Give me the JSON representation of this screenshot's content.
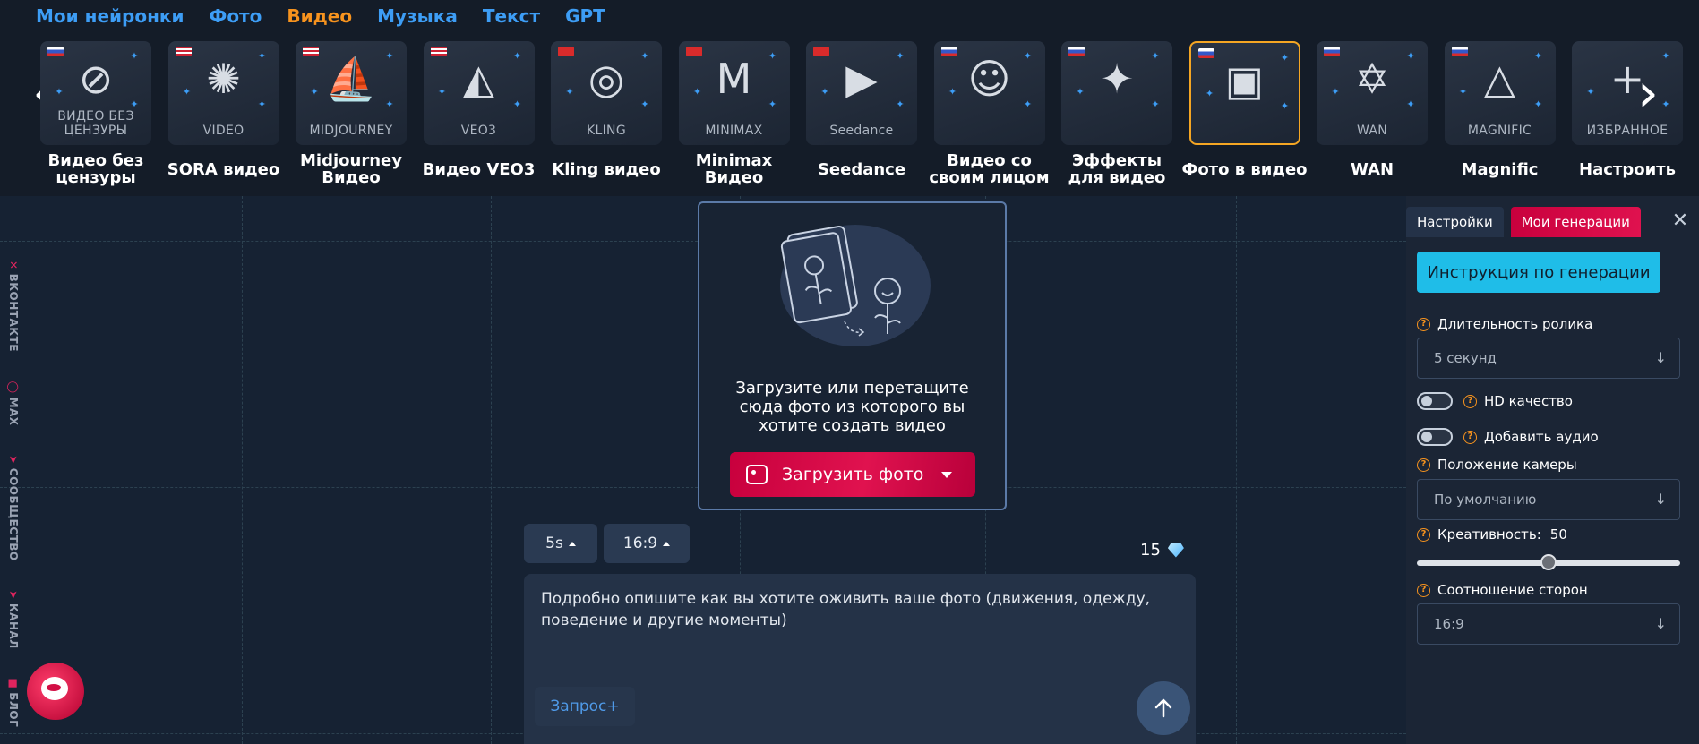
{
  "topnav": {
    "items": [
      {
        "label": "Мои нейронки",
        "active": false
      },
      {
        "label": "Фото",
        "active": false
      },
      {
        "label": "Видео",
        "active": true
      },
      {
        "label": "Музыка",
        "active": false
      },
      {
        "label": "Текст",
        "active": false
      },
      {
        "label": "GPT",
        "active": false
      }
    ]
  },
  "carousel": {
    "prev_icon": "chevron-left-icon",
    "next_icon": "chevron-right-icon",
    "cards": [
      {
        "sub": "ВИДЕО БЕЗ ЦЕНЗУРЫ",
        "title": "Видео без цензуры",
        "flag": "ru",
        "icon": "no-sign-icon",
        "glyph": "⊘"
      },
      {
        "sub": "VIDEO",
        "title": "SORA видео",
        "flag": "us",
        "icon": "sora-logo-icon",
        "glyph": "✺"
      },
      {
        "sub": "MIDJOURNEY",
        "title": "Midjourney Видео",
        "flag": "us",
        "icon": "midjourney-sail-icon",
        "glyph": "⛵"
      },
      {
        "sub": "VEO3",
        "title": "Видео VEO3",
        "flag": "us",
        "icon": "veo3-logo-icon",
        "glyph": "◭"
      },
      {
        "sub": "KLING",
        "title": "Kling видео",
        "flag": "cn",
        "icon": "kling-logo-icon",
        "glyph": "◎"
      },
      {
        "sub": "MINIMAX",
        "title": "Minimax Видео",
        "flag": "cn",
        "icon": "minimax-logo-icon",
        "glyph": "M"
      },
      {
        "sub": "Seedance",
        "title": "Seedance",
        "flag": "cn",
        "icon": "seedance-logo-icon",
        "glyph": "▶"
      },
      {
        "sub": "",
        "title": "Видео со своим лицом",
        "flag": "ru",
        "icon": "face-photo-icon",
        "glyph": "☺"
      },
      {
        "sub": "",
        "title": "Эффекты для видео",
        "flag": "ru",
        "icon": "effects-icon",
        "glyph": "✦"
      },
      {
        "sub": "",
        "title": "Фото в видео",
        "flag": "ru",
        "icon": "photo-to-video-icon",
        "glyph": "▣",
        "selected": true
      },
      {
        "sub": "WAN",
        "title": "WAN",
        "flag": "ru",
        "icon": "wan-logo-icon",
        "glyph": "✡"
      },
      {
        "sub": "MAGNIFIC",
        "title": "Magnific",
        "flag": "ru",
        "icon": "magnific-logo-icon",
        "glyph": "△"
      },
      {
        "sub": "ИЗБРАННОЕ",
        "title": "Настроить",
        "flag": "",
        "icon": "plus-icon",
        "glyph": "+"
      }
    ]
  },
  "sidelinks": {
    "items": [
      {
        "label": "ВКОНТАКТЕ",
        "icon": "vk-icon"
      },
      {
        "label": "MAX",
        "icon": "max-icon"
      },
      {
        "label": "СООБЩЕСТВО",
        "icon": "telegram-icon"
      },
      {
        "label": "КАНАЛ",
        "icon": "telegram-icon"
      },
      {
        "label": "БЛОГ",
        "icon": "blog-icon"
      }
    ]
  },
  "upload": {
    "text": "Загрузите или перетащите сюда фото из которого вы хотите создать видео",
    "button_label": "Загрузить фото",
    "illustration_icon": "photo-cards-icon"
  },
  "controls": {
    "duration_pill": "5s",
    "ratio_pill": "16:9",
    "cost": "15",
    "cost_icon": "diamond-icon"
  },
  "prompt": {
    "placeholder": "Подробно опишите как вы хотите оживить ваше фото (движения, одежду, поведение и другие моменты)",
    "zapros_label": "Запрос+",
    "send_icon": "arrow-up-icon"
  },
  "panel": {
    "tab_settings": "Настройки",
    "tab_generations": "Мои генерации",
    "instruction_button": "Инструкция по генерации",
    "duration_label": "Длительность ролика",
    "duration_value": "5 секунд",
    "hd_label": "HD качество",
    "hd_on": false,
    "audio_label": "Добавить аудио",
    "audio_on": false,
    "camera_label": "Положение камеры",
    "camera_value": "По умолчанию",
    "creativity_label": "Креативность:",
    "creativity_value": "50",
    "creativity_fraction": 0.5,
    "ratio_label": "Соотношение сторон",
    "ratio_value": "16:9"
  },
  "colors": {
    "accent_blue": "#3d9df5",
    "active_orange": "#f7931e",
    "brand_red": "#e0124f",
    "cyan_button": "#1fbde8"
  }
}
